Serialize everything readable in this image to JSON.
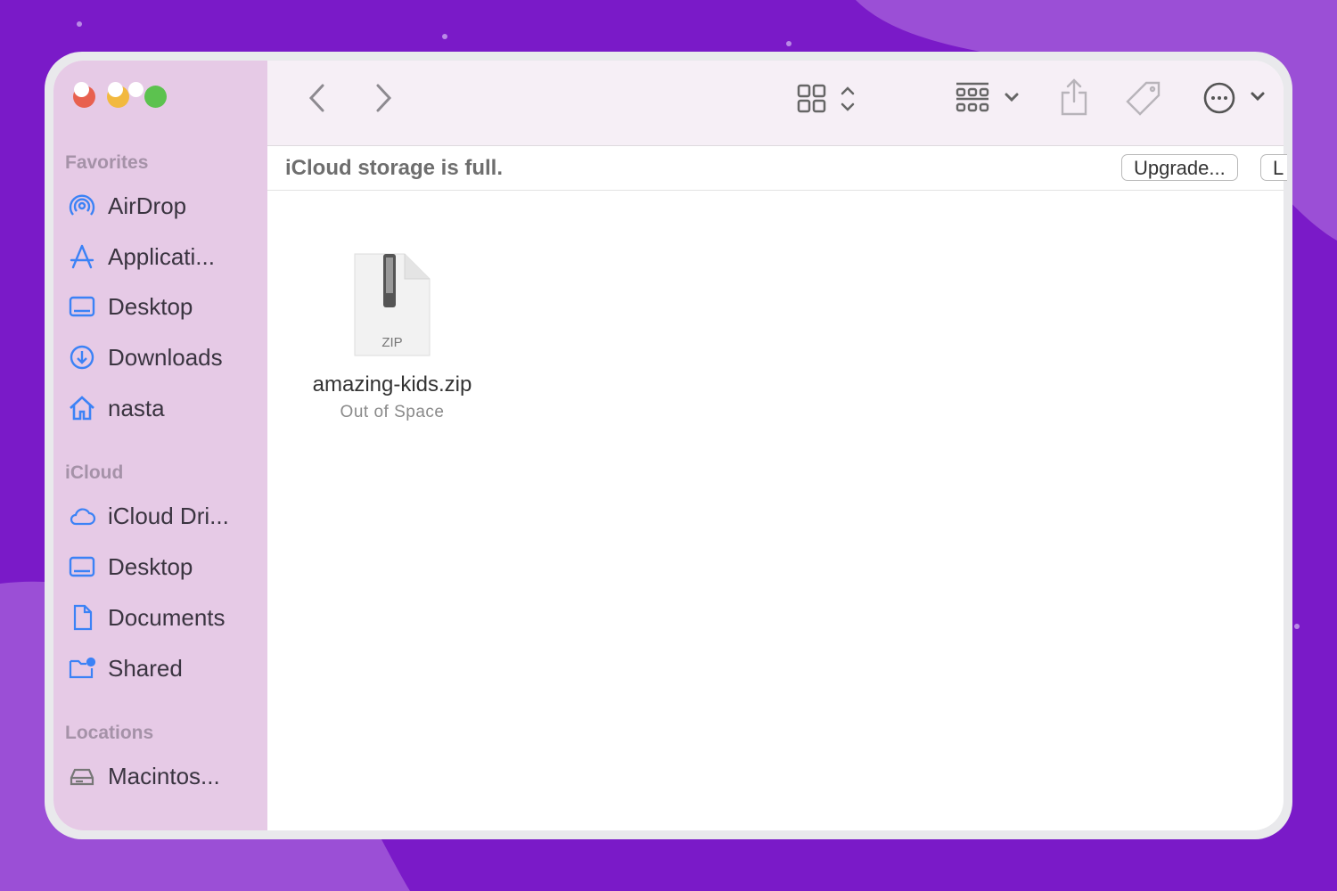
{
  "sidebar": {
    "sections": [
      {
        "title": "Favorites",
        "items": [
          {
            "label": "AirDrop",
            "icon": "airdrop-icon"
          },
          {
            "label": "Applicati...",
            "icon": "applications-icon"
          },
          {
            "label": "Desktop",
            "icon": "desktop-icon"
          },
          {
            "label": "Downloads",
            "icon": "downloads-icon"
          },
          {
            "label": "nasta",
            "icon": "home-icon"
          }
        ]
      },
      {
        "title": "iCloud",
        "items": [
          {
            "label": "iCloud Dri...",
            "icon": "cloud-icon"
          },
          {
            "label": "Desktop",
            "icon": "desktop-icon"
          },
          {
            "label": "Documents",
            "icon": "document-icon"
          },
          {
            "label": "Shared",
            "icon": "shared-folder-icon"
          }
        ]
      },
      {
        "title": "Locations",
        "items": [
          {
            "label": "Macintos...",
            "icon": "disk-icon"
          }
        ]
      }
    ]
  },
  "banner": {
    "text": "iCloud storage is full.",
    "upgrade_label": "Upgrade...",
    "second_label": "L"
  },
  "file": {
    "name": "amazing-kids.zip",
    "status": "Out of Space",
    "type_label": "ZIP"
  },
  "colors": {
    "background": "#7a1ac8",
    "sidebar": "#e6cae6",
    "accent": "#3b82f6"
  }
}
